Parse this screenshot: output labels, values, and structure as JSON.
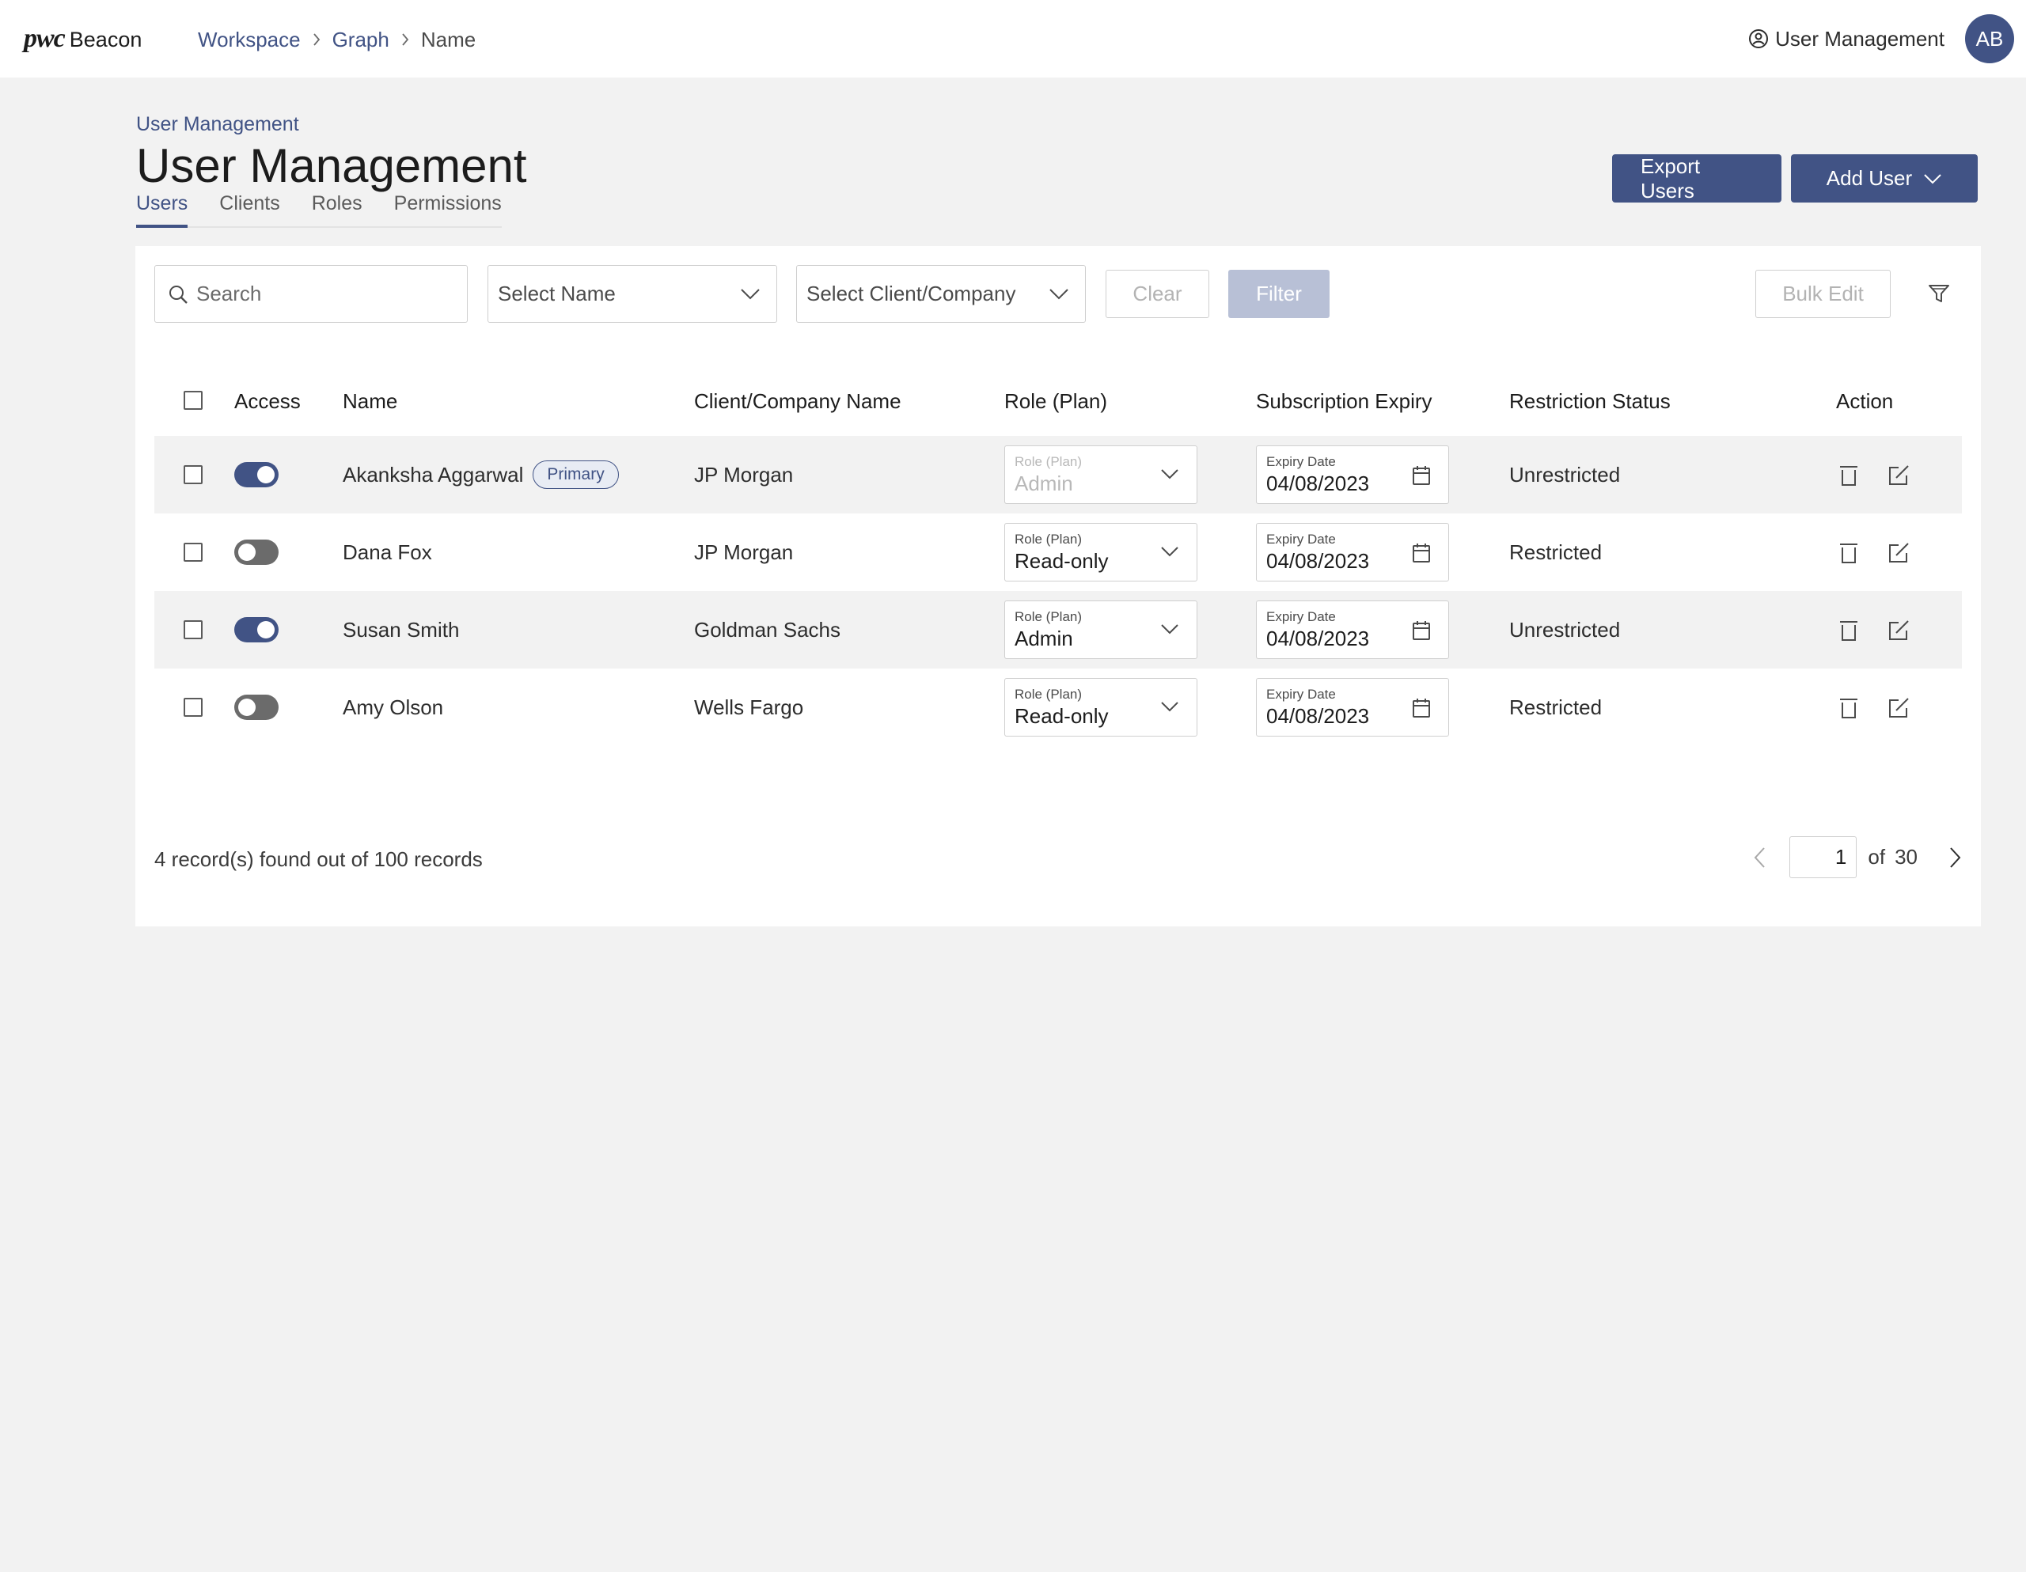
{
  "brand": {
    "logo_text": "pwc",
    "product": "Beacon"
  },
  "breadcrumb": {
    "items": [
      "Workspace",
      "Graph",
      "Name"
    ]
  },
  "top_right": {
    "user_management_label": "User Management",
    "avatar_initials": "AB"
  },
  "page": {
    "sub_crumb": "User Management",
    "title": "User Management",
    "tabs": [
      {
        "label": "Users",
        "active": true
      },
      {
        "label": "Clients",
        "active": false
      },
      {
        "label": "Roles",
        "active": false
      },
      {
        "label": "Permissions",
        "active": false
      }
    ],
    "export_button": "Export Users",
    "add_button": "Add User"
  },
  "filters": {
    "search_placeholder": "Search",
    "name_select": "Select Name",
    "client_select": "Select Client/Company",
    "clear_label": "Clear",
    "filter_label": "Filter",
    "bulk_edit_label": "Bulk Edit"
  },
  "table": {
    "columns": [
      "Access",
      "Name",
      "Client/Company Name",
      "Role (Plan)",
      "Subscription Expiry",
      "Restriction Status",
      "Action"
    ],
    "rows": [
      {
        "access": true,
        "name": "Akanksha Aggarwal",
        "badge": "Primary",
        "company": "JP Morgan",
        "role_label": "Role (Plan)",
        "role": "Admin",
        "role_disabled": true,
        "expiry_label": "Expiry Date",
        "expiry": "04/08/2023",
        "status": "Unrestricted"
      },
      {
        "access": false,
        "name": "Dana Fox",
        "badge": "",
        "company": "JP Morgan",
        "role_label": "Role (Plan)",
        "role": "Read-only",
        "role_disabled": false,
        "expiry_label": "Expiry Date",
        "expiry": "04/08/2023",
        "status": "Restricted"
      },
      {
        "access": true,
        "name": "Susan Smith",
        "badge": "",
        "company": "Goldman Sachs",
        "role_label": "Role (Plan)",
        "role": "Admin",
        "role_disabled": false,
        "expiry_label": "Expiry Date",
        "expiry": "04/08/2023",
        "status": "Unrestricted"
      },
      {
        "access": false,
        "name": "Amy Olson",
        "badge": "",
        "company": "Wells Fargo",
        "role_label": "Role (Plan)",
        "role": "Read-only",
        "role_disabled": false,
        "expiry_label": "Expiry Date",
        "expiry": "04/08/2023",
        "status": "Restricted"
      }
    ]
  },
  "footer": {
    "records_text": "4 record(s) found out of 100 records",
    "current_page": "1",
    "of_label": "of",
    "total_pages": "30"
  },
  "colors": {
    "primary": "#415385",
    "disabled_fill": "#b8c0d6",
    "background": "#f2f2f2",
    "row_shade": "#f2f2f2"
  },
  "icons": [
    "search-icon",
    "chevron-down-icon",
    "filter-icon",
    "calendar-icon",
    "delete-icon",
    "edit-icon",
    "chevron-left-icon",
    "chevron-right-icon",
    "user-circle-icon"
  ]
}
